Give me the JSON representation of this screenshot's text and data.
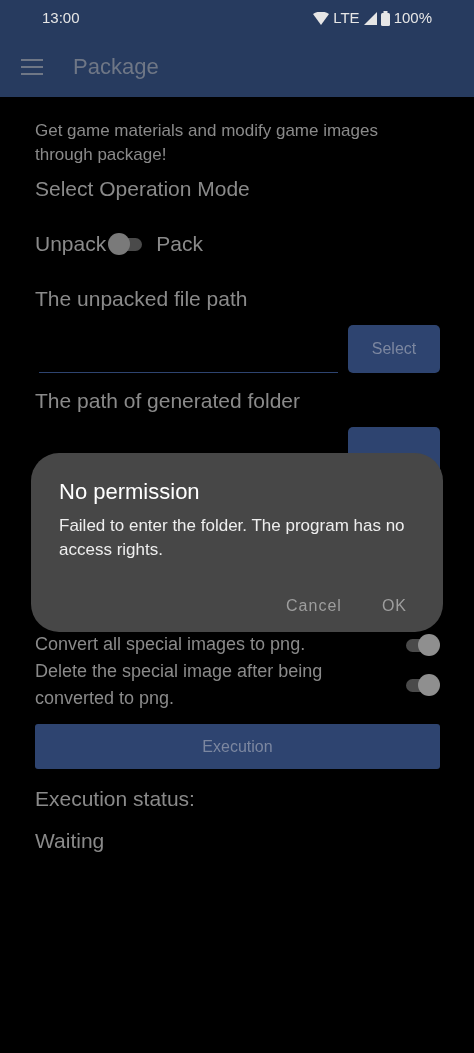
{
  "status_bar": {
    "time": "13:00",
    "network": "LTE",
    "battery": "100%"
  },
  "app_bar": {
    "title": "Package"
  },
  "intro": "Get game materials and modify game images through package!",
  "mode": {
    "heading": "Select Operation Mode",
    "left_label": "Unpack",
    "right_label": "Pack",
    "on": false
  },
  "paths": [
    {
      "label": "The unpacked file path",
      "button": "Select"
    },
    {
      "label": "The path of generated folder"
    }
  ],
  "options": [
    {
      "label": "Convert all special images to png.",
      "on": true
    },
    {
      "label": "Delete the special image after being converted to png.",
      "on": true
    }
  ],
  "execute_button": "Execution",
  "status": {
    "label": "Execution status:",
    "value": "Waiting"
  },
  "dialog": {
    "title": "No permission",
    "message": "Failed to enter the folder. The program has no access rights.",
    "buttons": [
      "Cancel",
      "OK"
    ]
  }
}
